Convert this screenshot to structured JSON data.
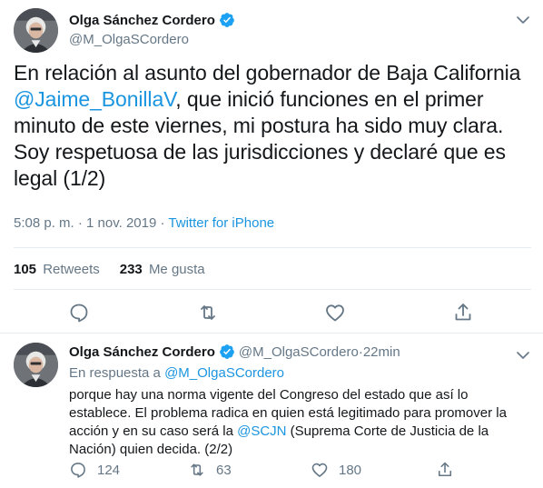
{
  "main_tweet": {
    "author_name": "Olga Sánchez Cordero",
    "author_handle": "@M_OlgaSCordero",
    "text_before": "En relación al asunto del gobernador de Baja California ",
    "mention": "@Jaime_BonillaV",
    "text_after": ", que inició funciones en el primer minuto de este viernes, mi postura ha sido muy clara. Soy respetuosa de las jurisdicciones y declaré que es legal (1/2)",
    "time": "5:08 p. m.",
    "separator": " · ",
    "date": "1 nov. 2019",
    "source": "Twitter for iPhone",
    "retweets_count": "105",
    "retweets_label": "Retweets",
    "likes_count": "233",
    "likes_label": "Me gusta"
  },
  "reply_tweet": {
    "author_name": "Olga Sánchez Cordero",
    "author_handle": "@M_OlgaSCordero",
    "separator": " · ",
    "age": "22min",
    "in_reply_label": "En respuesta a ",
    "in_reply_handle": "@M_OlgaSCordero",
    "text_before": "porque hay una norma vigente del Congreso del estado que así lo establece. El problema radica en quien está legitimado para promover la acción y en su caso será la ",
    "mention": "@SCJN",
    "text_after": " (Suprema Corte de Justicia de la Nación) quien decida. (2/2)",
    "reply_count": "124",
    "retweet_count": "63",
    "like_count": "180"
  },
  "icons": {
    "verified": "verified-badge-icon",
    "chevron": "chevron-down-icon",
    "reply": "reply-icon",
    "retweet": "retweet-icon",
    "like": "heart-icon",
    "share": "share-icon"
  },
  "colors": {
    "link": "#1b95e0",
    "muted": "#657786",
    "text": "#14171a",
    "divider": "#e6ecf0"
  }
}
